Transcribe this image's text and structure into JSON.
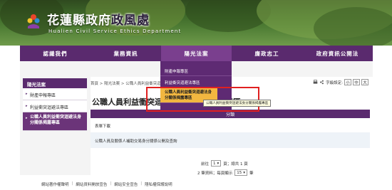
{
  "site": {
    "title_main": "花蓮縣政府",
    "title_highlight": "政風處",
    "subtitle": "Hualien Civil Service Ethics Department"
  },
  "nav": [
    {
      "label": "認識我們"
    },
    {
      "label": "業務資訊"
    },
    {
      "label": "陽光法案"
    },
    {
      "label": "廉政志工"
    },
    {
      "label": "政府資訊公開法"
    }
  ],
  "dropdown": {
    "items": [
      {
        "label": "財產申報專區"
      },
      {
        "label": "利益衝突迴避法專區"
      },
      {
        "label": "公職人員利益衝突迴避法身分關係揭露專區"
      }
    ],
    "tooltip": "公職人員利益衝突迴避法身分關係揭露專區"
  },
  "sidebar": {
    "header": "陽光法案",
    "items": [
      {
        "label": "財產申報專區"
      },
      {
        "label": "利益衝突迴避法專區"
      },
      {
        "label": "公職人員利益衝突迴避法身分關係揭露專區"
      }
    ]
  },
  "breadcrumb": {
    "home": "首頁",
    "sep": ">",
    "level1": "陽光法案",
    "level2": "公職人員利益衝突迴避法身分關係揭露專區"
  },
  "font_size": {
    "label": "字級設定:",
    "options": [
      "小",
      "中",
      "大"
    ]
  },
  "page": {
    "title": "公職人員利益衝突迴避法身分關係揭露專區"
  },
  "category_bar": "分類",
  "section_head": "表單下載",
  "rows": [
    {
      "text": "公職人員及關係人補助交易身分關係公開及查詢"
    }
  ],
  "pager": {
    "prev": "前往",
    "page_value": "1",
    "page_suffix": "頁；總共 1 頁",
    "count_text": "2 筆資料；每頁顯示",
    "per_page_value": "15",
    "per_page_suffix": "筆"
  },
  "footer": {
    "links": [
      "網站著作權聲明",
      "網站資料開放宣告",
      "網站安全宣告",
      "隱私權保護說明"
    ]
  },
  "colors": {
    "primary": "#5a2a6e",
    "nav_active": "#7a3f8e",
    "hover": "#f2b740",
    "highlight_border": "#e02020"
  }
}
